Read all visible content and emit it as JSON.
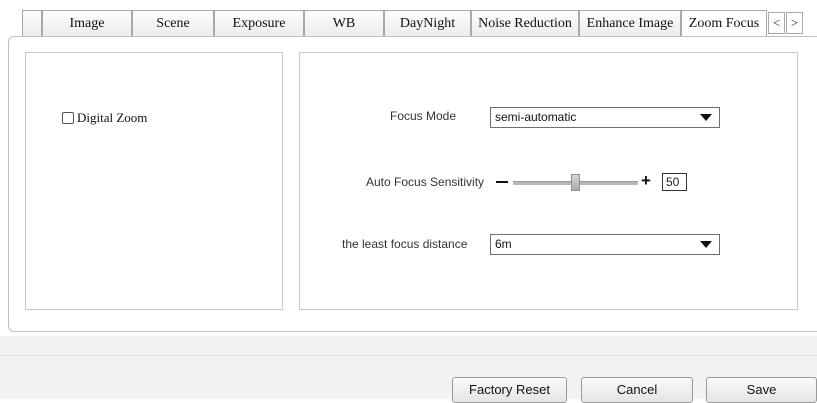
{
  "tabs": [
    {
      "label": "Image"
    },
    {
      "label": "Scene"
    },
    {
      "label": "Exposure"
    },
    {
      "label": "WB"
    },
    {
      "label": "DayNight"
    },
    {
      "label": "Noise Reduction"
    },
    {
      "label": "Enhance Image"
    },
    {
      "label": "Zoom Focus",
      "active": true
    }
  ],
  "tab_nav": {
    "prev": "<",
    "next": ">"
  },
  "digital_zoom": {
    "label": "Digital Zoom",
    "checked": false
  },
  "focus_mode": {
    "label": "Focus Mode",
    "value": "semi-automatic"
  },
  "auto_focus_sensitivity": {
    "label": "Auto Focus Sensitivity",
    "value": "50",
    "min": 0,
    "max": 100
  },
  "least_focus_distance": {
    "label": "the least focus distance",
    "value": "6m"
  },
  "buttons": {
    "factory_reset": "Factory Reset",
    "cancel": "Cancel",
    "save": "Save"
  }
}
